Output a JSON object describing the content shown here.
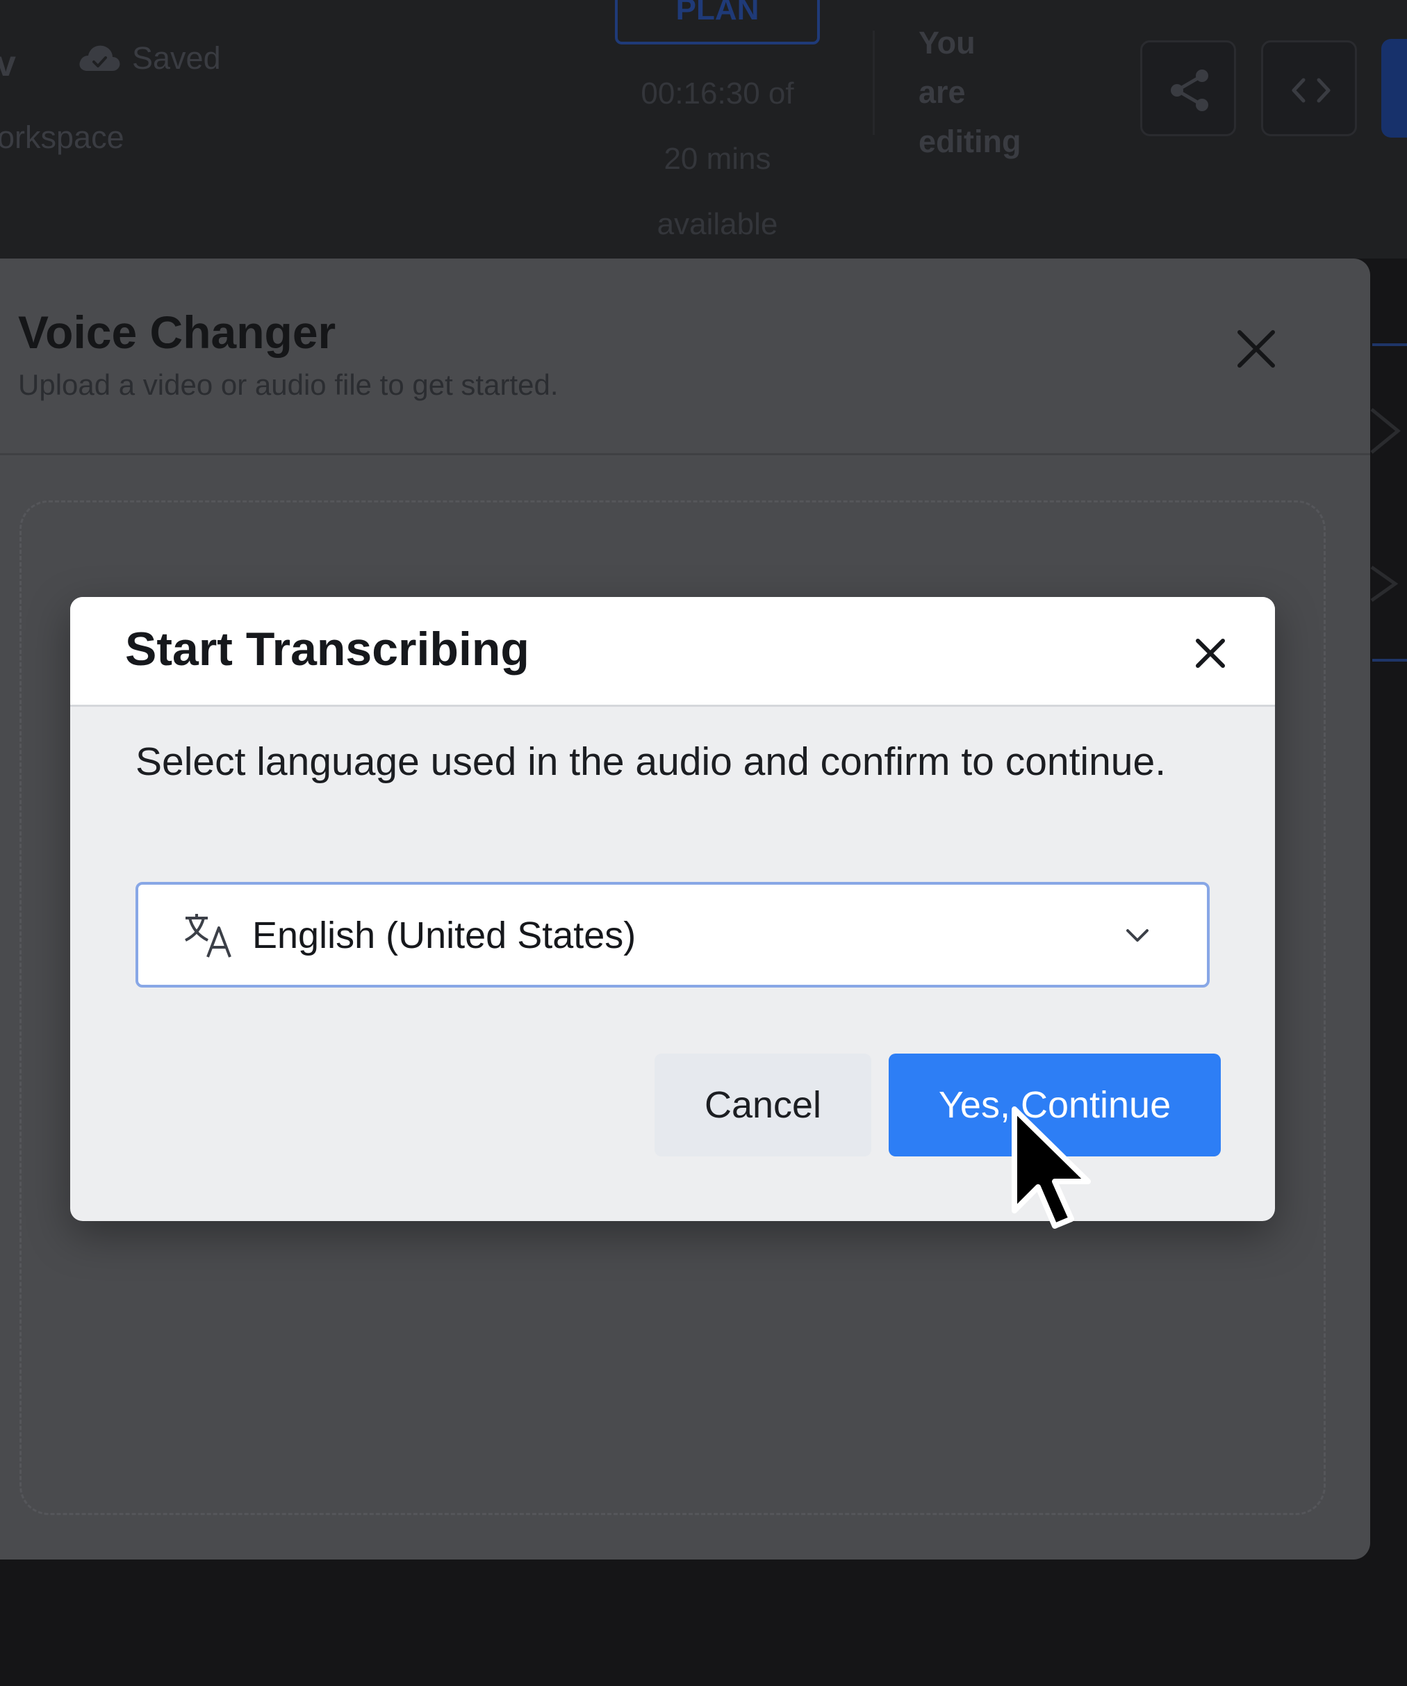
{
  "background_header": {
    "title_fragment": "v",
    "saved_label": "Saved",
    "workspace_fragment": "orkspace",
    "plan_badge": "PLAN",
    "usage_line1": "00:16:30 of",
    "usage_line2": "20 mins",
    "usage_line3": "available",
    "editing_line1": "You",
    "editing_line2": "are",
    "editing_line3": "editing"
  },
  "voice_changer_modal": {
    "title": "Voice Changer",
    "subtitle": "Upload a video or audio file to get started."
  },
  "dialog": {
    "title": "Start Transcribing",
    "message": "Select language used in the audio and confirm to continue.",
    "language_select": {
      "selected": "English (United States)",
      "icon": "translate-icon"
    },
    "cancel_label": "Cancel",
    "continue_label": "Yes, Continue"
  },
  "colors": {
    "accent": "#2d7ef5",
    "select_border": "#88a7e6",
    "dialog_bg": "#edeef0",
    "overlay_dark": "#151517"
  },
  "icons": {
    "cloud": "cloud-icon",
    "share": "share-icon",
    "embed": "code-icon",
    "close": "close-icon",
    "chevron": "chevron-down-icon",
    "cursor": "mouse-pointer-icon"
  }
}
